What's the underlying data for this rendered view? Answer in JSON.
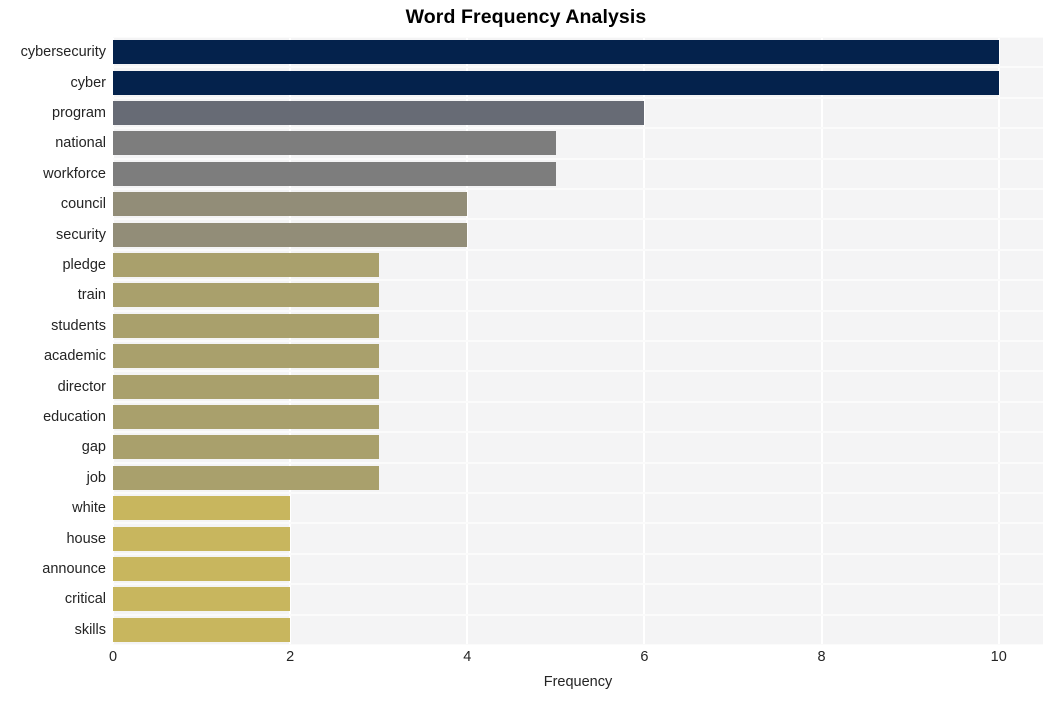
{
  "chart_data": {
    "type": "bar",
    "orientation": "horizontal",
    "title": "Word Frequency Analysis",
    "xlabel": "Frequency",
    "ylabel": "",
    "categories": [
      "cybersecurity",
      "cyber",
      "program",
      "national",
      "workforce",
      "council",
      "security",
      "pledge",
      "train",
      "students",
      "academic",
      "director",
      "education",
      "gap",
      "job",
      "white",
      "house",
      "announce",
      "critical",
      "skills"
    ],
    "values": [
      10,
      10,
      6,
      5,
      5,
      4,
      4,
      3,
      3,
      3,
      3,
      3,
      3,
      3,
      3,
      2,
      2,
      2,
      2,
      2
    ],
    "bar_colors": [
      "#04224c",
      "#04224c",
      "#676b75",
      "#7d7d7d",
      "#7d7d7d",
      "#928d78",
      "#928d78",
      "#a9a06c",
      "#a9a06c",
      "#a9a06c",
      "#a9a06c",
      "#a9a06c",
      "#a9a06c",
      "#a9a06c",
      "#a9a06c",
      "#c8b65e",
      "#c8b65e",
      "#c8b65e",
      "#c8b65e",
      "#c8b65e"
    ],
    "xticks": [
      0,
      2,
      4,
      6,
      8,
      10
    ],
    "xtick_labels": [
      "0",
      "2",
      "4",
      "6",
      "8",
      "10"
    ],
    "xlim": [
      0,
      10.5
    ],
    "grid": true,
    "legend": false,
    "plot_background": "#f4f4f5",
    "figure_background": "#ffffff",
    "gridline_color": "#ffffff",
    "title_color": "#000000",
    "tick_label_color": "#242424"
  }
}
